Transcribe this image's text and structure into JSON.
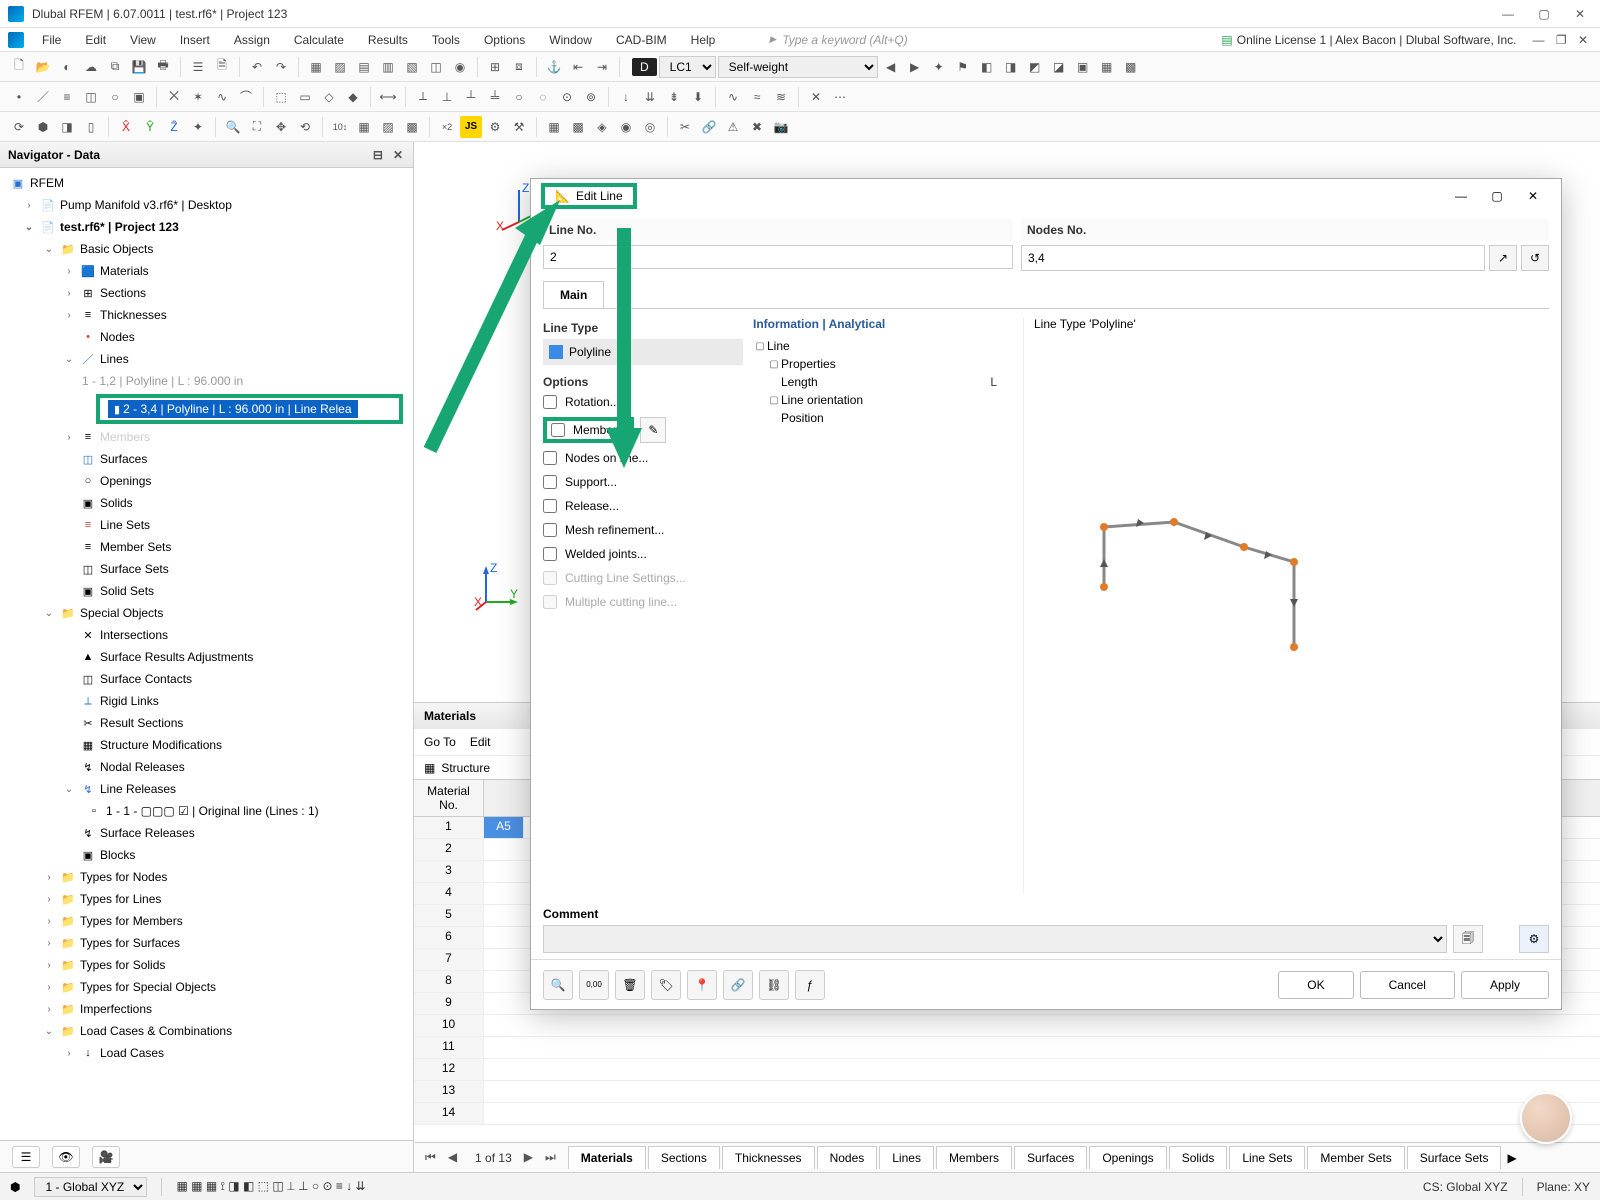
{
  "app": {
    "title": "Dlubal RFEM | 6.07.0011 | test.rf6* | Project 123",
    "win": {
      "min": "—",
      "max": "▢",
      "close": "✕"
    }
  },
  "menu": {
    "items": [
      "File",
      "Edit",
      "View",
      "Insert",
      "Assign",
      "Calculate",
      "Results",
      "Tools",
      "Options",
      "Window",
      "CAD-BIM",
      "Help"
    ],
    "search_placeholder": "Type a keyword (Alt+Q)",
    "license": "Online License 1 | Alex Bacon | Dlubal Software, Inc."
  },
  "toolbar1": {
    "lc_badge": "D",
    "lc_code": "LC1",
    "lc_name": "Self-weight"
  },
  "navigator": {
    "title": "Navigator - Data",
    "root": "RFEM",
    "projects": [
      "Pump Manifold v3.rf6* | Desktop",
      "test.rf6* | Project 123"
    ],
    "basic_objects": {
      "label": "Basic Objects",
      "children": [
        "Materials",
        "Sections",
        "Thicknesses",
        "Nodes",
        "Lines"
      ],
      "line_items": [
        "1 - 1,2 | Polyline | L : 96.000 in",
        "2 - 3,4 | Polyline | L : 96.000 in | Line Relea"
      ],
      "after_lines": [
        "Members",
        "Surfaces",
        "Openings",
        "Solids",
        "Line Sets",
        "Member Sets",
        "Surface Sets",
        "Solid Sets"
      ]
    },
    "special_objects": {
      "label": "Special Objects",
      "children": [
        "Intersections",
        "Surface Results Adjustments",
        "Surface Contacts",
        "Rigid Links",
        "Result Sections",
        "Structure Modifications",
        "Nodal Releases",
        "Line Releases"
      ],
      "line_release_item": "1 - 1 - ▢▢▢ ☑ | Original line (Lines : 1)",
      "after_lr": [
        "Surface Releases",
        "Blocks"
      ]
    },
    "types": [
      "Types for Nodes",
      "Types for Lines",
      "Types for Members",
      "Types for Surfaces",
      "Types for Solids",
      "Types for Special Objects",
      "Imperfections",
      "Load Cases & Combinations"
    ],
    "lcc_child": "Load Cases"
  },
  "materials": {
    "title": "Materials",
    "tools": [
      "Go To",
      "Edit"
    ],
    "structure": "Structure",
    "header": "Material\nNo.",
    "rows": [
      1,
      2,
      3,
      4,
      5,
      6,
      7,
      8,
      9,
      10,
      11,
      12,
      13,
      14
    ],
    "first_val": "A5"
  },
  "bottom_tabs": {
    "page": "1 of 13",
    "tabs": [
      "Materials",
      "Sections",
      "Thicknesses",
      "Nodes",
      "Lines",
      "Members",
      "Surfaces",
      "Openings",
      "Solids",
      "Line Sets",
      "Member Sets",
      "Surface Sets"
    ]
  },
  "status": {
    "cs_selector": "1 - Global XYZ",
    "cs": "CS: Global XYZ",
    "plane": "Plane: XY"
  },
  "dialog": {
    "title": "Edit Line",
    "line_no_label": "Line No.",
    "line_no": "2",
    "nodes_label": "Nodes No.",
    "nodes": "3,4",
    "tab_main": "Main",
    "line_type_label": "Line Type",
    "line_type": "Polyline",
    "options_label": "Options",
    "options": {
      "rotation": "Rotation...",
      "member": "Member...",
      "nodes_on_line": "Nodes on line...",
      "support": "Support...",
      "release": "Release...",
      "mesh": "Mesh refinement...",
      "welded": "Welded joints...",
      "cutting": "Cutting Line Settings...",
      "multi_cut": "Multiple cutting line..."
    },
    "info_header": "Information | Analytical",
    "info": {
      "line": "Line",
      "properties": "Properties",
      "length": "Length",
      "length_sym": "L",
      "orientation": "Line orientation",
      "position": "Position"
    },
    "right_title": "Line Type 'Polyline'",
    "comment_label": "Comment",
    "buttons": {
      "ok": "OK",
      "cancel": "Cancel",
      "apply": "Apply"
    }
  }
}
